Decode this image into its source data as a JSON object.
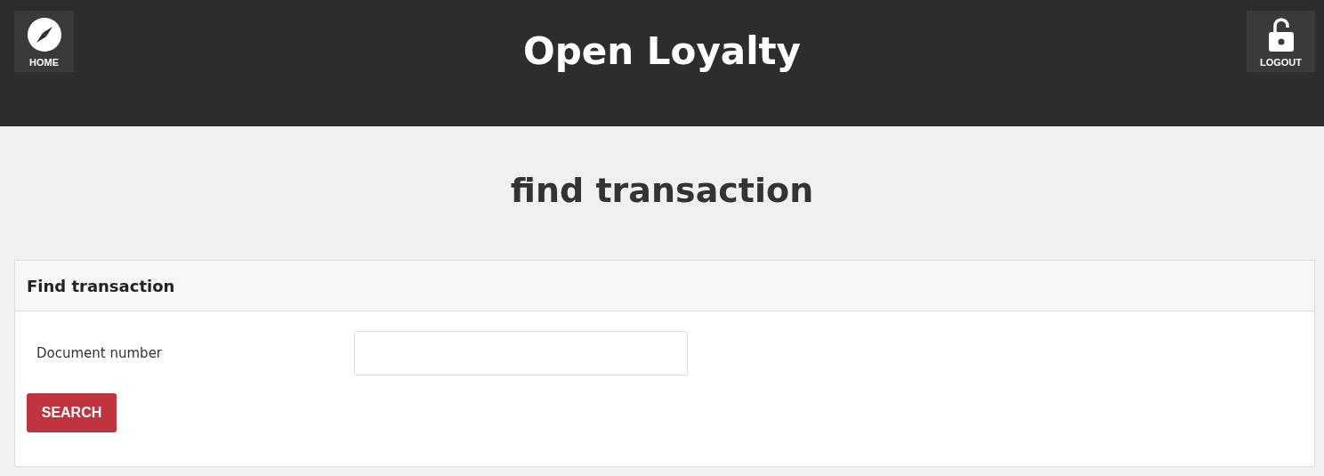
{
  "header": {
    "title": "Open Loyalty",
    "home_button": {
      "label": "HOME"
    },
    "logout_button": {
      "label": "LOGOUT"
    }
  },
  "page_title": "find transaction",
  "panel": {
    "title": "Find transaction",
    "fields": [
      {
        "label": "Document number"
      }
    ],
    "search_button": "SEARCH"
  }
}
